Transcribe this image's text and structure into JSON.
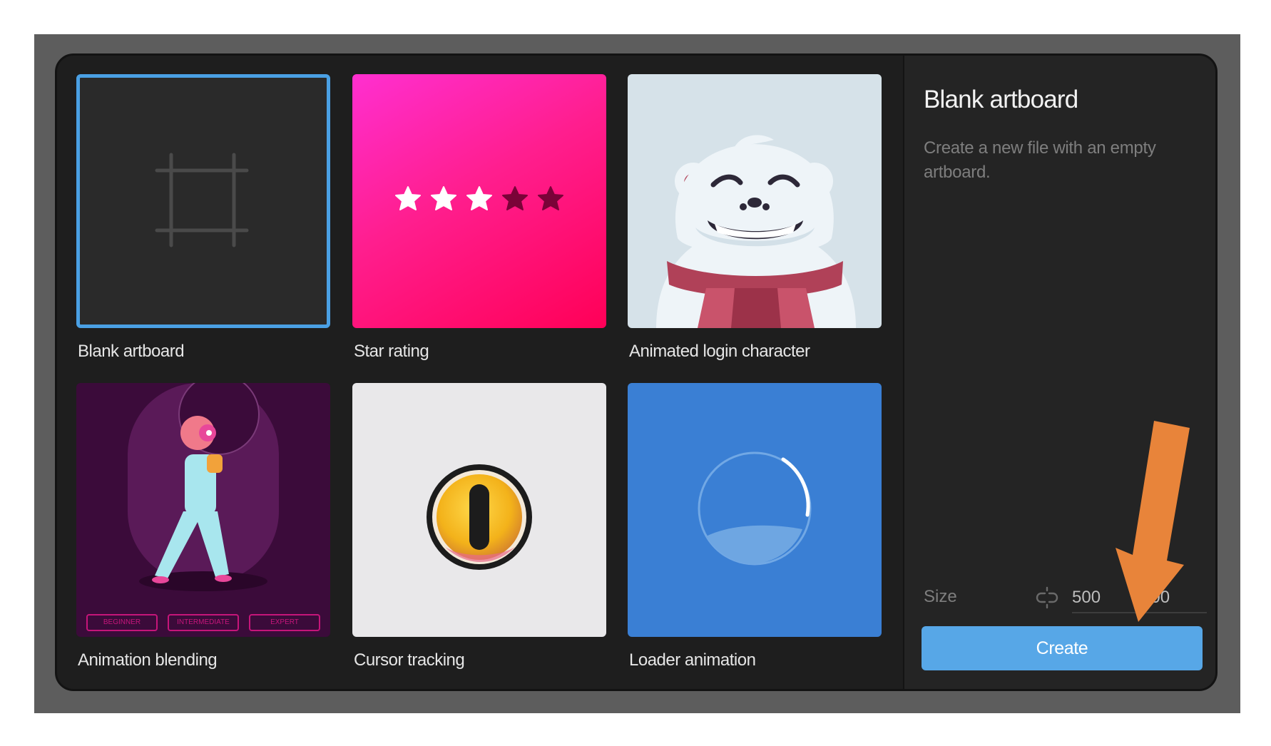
{
  "templates": [
    {
      "label": "Blank artboard",
      "thumb": "blank-artboard-icon",
      "selected": true
    },
    {
      "label": "Star rating",
      "thumb": "five-stars-three-filled",
      "rating": 3,
      "max": 5
    },
    {
      "label": "Animated login character",
      "thumb": "yeti-character"
    },
    {
      "label": "Animation blending",
      "thumb": "walking-girl",
      "badges": [
        "BEGINNER",
        "INTERMEDIATE",
        "EXPERT"
      ]
    },
    {
      "label": "Cursor tracking",
      "thumb": "eye-button"
    },
    {
      "label": "Loader animation",
      "thumb": "circular-loader"
    }
  ],
  "panel": {
    "title": "Blank artboard",
    "description": "Create a new file with an empty artboard.",
    "size_label": "Size",
    "width_value": "500",
    "height_value": "500",
    "create_label": "Create"
  },
  "colors": {
    "accent": "#57a7e7",
    "selection": "#4aa0e4",
    "dialog_bg": "#1e1e1e",
    "annotation_arrow": "#e8843a"
  }
}
